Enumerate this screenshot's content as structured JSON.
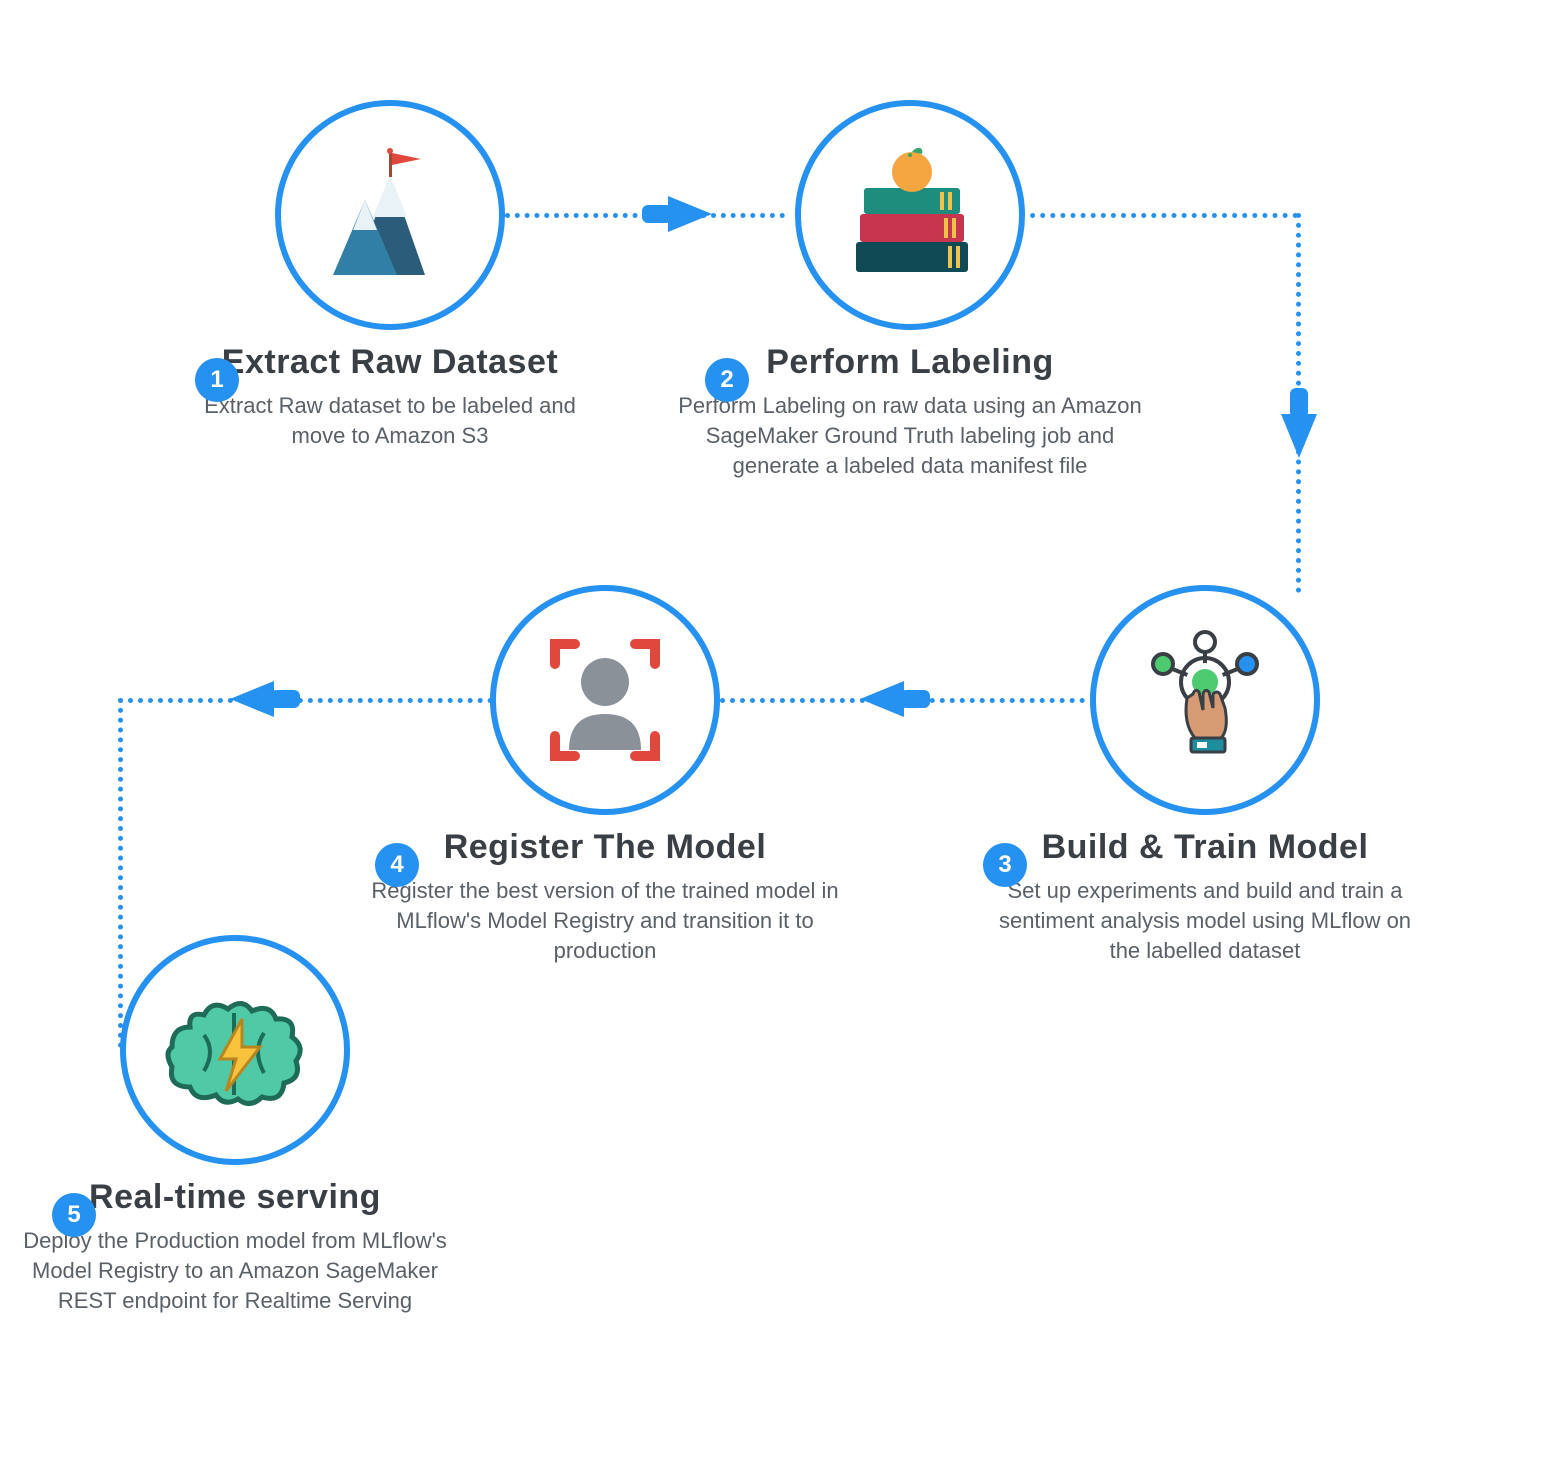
{
  "colors": {
    "accent": "#2591f0",
    "text": "#3a3f45",
    "muted": "#5a6068"
  },
  "steps": {
    "s1": {
      "number": "1",
      "title": "Extract Raw Dataset",
      "desc": "Extract Raw dataset to be labeled and move to Amazon S3",
      "icon": "mountain-flag-icon"
    },
    "s2": {
      "number": "2",
      "title": "Perform Labeling",
      "desc": "Perform Labeling on raw data using an Amazon SageMaker Ground Truth labeling job and generate a labeled data manifest file",
      "icon": "books-orange-icon"
    },
    "s3": {
      "number": "3",
      "title": "Build & Train Model",
      "desc": "Set up experiments and build and train a sentiment analysis model using MLflow on the labelled dataset",
      "icon": "hand-nodes-icon"
    },
    "s4": {
      "number": "4",
      "title": "Register The Model",
      "desc": "Register the best version of the trained model in MLflow's Model Registry and transition it to production",
      "icon": "avatar-frame-icon"
    },
    "s5": {
      "number": "5",
      "title": "Real-time serving",
      "desc": "Deploy the Production model from MLflow's Model Registry to an Amazon SageMaker REST endpoint for Realtime Serving",
      "icon": "brain-bolt-icon"
    }
  },
  "flow": [
    "s1",
    "s2",
    "s3",
    "s4",
    "s5"
  ]
}
